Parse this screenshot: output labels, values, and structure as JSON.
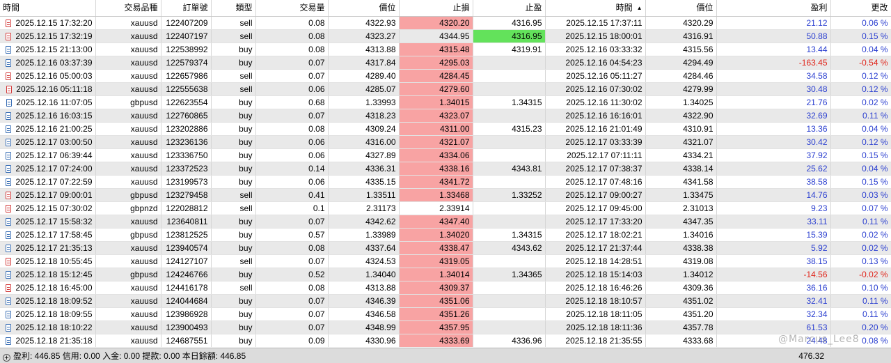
{
  "columns": {
    "open_time": "時間",
    "symbol": "交易品種",
    "order": "訂單號",
    "type": "類型",
    "volume": "交易量",
    "open_price": "價位",
    "sl": "止損",
    "tp": "止盈",
    "close_time": "時間",
    "close_price": "價位",
    "profit": "盈利",
    "change": "更改"
  },
  "rows": [
    {
      "open_time": "2025.12.15 17:32:20",
      "symbol": "xauusd",
      "order": "122407209",
      "type": "sell",
      "volume": "0.08",
      "open_price": "4322.93",
      "sl": "4320.20",
      "tp": "4316.95",
      "close_time": "2025.12.15 17:37:11",
      "close_price": "4320.29",
      "profit": "21.12",
      "change": "0.06 %"
    },
    {
      "open_time": "2025.12.15 17:32:19",
      "symbol": "xauusd",
      "order": "122407197",
      "type": "sell",
      "volume": "0.08",
      "open_price": "4323.27",
      "sl": "4344.95",
      "tp": "4316.95",
      "close_time": "2025.12.15 18:00:01",
      "close_price": "4316.91",
      "profit": "50.88",
      "change": "0.15 %"
    },
    {
      "open_time": "2025.12.15 21:13:00",
      "symbol": "xauusd",
      "order": "122538992",
      "type": "buy",
      "volume": "0.08",
      "open_price": "4313.88",
      "sl": "4315.48",
      "tp": "4319.91",
      "close_time": "2025.12.16 03:33:32",
      "close_price": "4315.56",
      "profit": "13.44",
      "change": "0.04 %"
    },
    {
      "open_time": "2025.12.16 03:37:39",
      "symbol": "xauusd",
      "order": "122579374",
      "type": "buy",
      "volume": "0.07",
      "open_price": "4317.84",
      "sl": "4295.03",
      "tp": "",
      "close_time": "2025.12.16 04:54:23",
      "close_price": "4294.49",
      "profit": "-163.45",
      "change": "-0.54 %"
    },
    {
      "open_time": "2025.12.16 05:00:03",
      "symbol": "xauusd",
      "order": "122657986",
      "type": "sell",
      "volume": "0.07",
      "open_price": "4289.40",
      "sl": "4284.45",
      "tp": "",
      "close_time": "2025.12.16 05:11:27",
      "close_price": "4284.46",
      "profit": "34.58",
      "change": "0.12 %"
    },
    {
      "open_time": "2025.12.16 05:11:18",
      "symbol": "xauusd",
      "order": "122555638",
      "type": "sell",
      "volume": "0.06",
      "open_price": "4285.07",
      "sl": "4279.60",
      "tp": "",
      "close_time": "2025.12.16 07:30:02",
      "close_price": "4279.99",
      "profit": "30.48",
      "change": "0.12 %"
    },
    {
      "open_time": "2025.12.16 11:07:05",
      "symbol": "gbpusd",
      "order": "122623554",
      "type": "buy",
      "volume": "0.68",
      "open_price": "1.33993",
      "sl": "1.34015",
      "tp": "1.34315",
      "close_time": "2025.12.16 11:30:02",
      "close_price": "1.34025",
      "profit": "21.76",
      "change": "0.02 %"
    },
    {
      "open_time": "2025.12.16 16:03:15",
      "symbol": "xauusd",
      "order": "122760865",
      "type": "buy",
      "volume": "0.07",
      "open_price": "4318.23",
      "sl": "4323.07",
      "tp": "",
      "close_time": "2025.12.16 16:16:01",
      "close_price": "4322.90",
      "profit": "32.69",
      "change": "0.11 %"
    },
    {
      "open_time": "2025.12.16 21:00:25",
      "symbol": "xauusd",
      "order": "123202886",
      "type": "buy",
      "volume": "0.08",
      "open_price": "4309.24",
      "sl": "4311.00",
      "tp": "4315.23",
      "close_time": "2025.12.16 21:01:49",
      "close_price": "4310.91",
      "profit": "13.36",
      "change": "0.04 %"
    },
    {
      "open_time": "2025.12.17 03:00:50",
      "symbol": "xauusd",
      "order": "123236136",
      "type": "buy",
      "volume": "0.06",
      "open_price": "4316.00",
      "sl": "4321.07",
      "tp": "",
      "close_time": "2025.12.17 03:33:39",
      "close_price": "4321.07",
      "profit": "30.42",
      "change": "0.12 %"
    },
    {
      "open_time": "2025.12.17 06:39:44",
      "symbol": "xauusd",
      "order": "123336750",
      "type": "buy",
      "volume": "0.06",
      "open_price": "4327.89",
      "sl": "4334.06",
      "tp": "",
      "close_time": "2025.12.17 07:11:11",
      "close_price": "4334.21",
      "profit": "37.92",
      "change": "0.15 %"
    },
    {
      "open_time": "2025.12.17 07:24:00",
      "symbol": "xauusd",
      "order": "123372523",
      "type": "buy",
      "volume": "0.14",
      "open_price": "4336.31",
      "sl": "4338.16",
      "tp": "4343.81",
      "close_time": "2025.12.17 07:38:37",
      "close_price": "4338.14",
      "profit": "25.62",
      "change": "0.04 %"
    },
    {
      "open_time": "2025.12.17 07:22:59",
      "symbol": "xauusd",
      "order": "123199573",
      "type": "buy",
      "volume": "0.06",
      "open_price": "4335.15",
      "sl": "4341.72",
      "tp": "",
      "close_time": "2025.12.17 07:48:16",
      "close_price": "4341.58",
      "profit": "38.58",
      "change": "0.15 %"
    },
    {
      "open_time": "2025.12.17 09:00:01",
      "symbol": "gbpusd",
      "order": "123279458",
      "type": "sell",
      "volume": "0.41",
      "open_price": "1.33511",
      "sl": "1.33468",
      "tp": "1.33252",
      "close_time": "2025.12.17 09:00:27",
      "close_price": "1.33475",
      "profit": "14.76",
      "change": "0.03 %"
    },
    {
      "open_time": "2025.12.15 07:30:02",
      "symbol": "gbpnzd",
      "order": "122028812",
      "type": "sell",
      "volume": "0.1",
      "open_price": "2.31173",
      "sl": "2.33914",
      "tp": "",
      "close_time": "2025.12.17 09:45:00",
      "close_price": "2.31013",
      "profit": "9.23",
      "change": "0.07 %"
    },
    {
      "open_time": "2025.12.17 15:58:32",
      "symbol": "xauusd",
      "order": "123640811",
      "type": "buy",
      "volume": "0.07",
      "open_price": "4342.62",
      "sl": "4347.40",
      "tp": "",
      "close_time": "2025.12.17 17:33:20",
      "close_price": "4347.35",
      "profit": "33.11",
      "change": "0.11 %"
    },
    {
      "open_time": "2025.12.17 17:58:45",
      "symbol": "gbpusd",
      "order": "123812525",
      "type": "buy",
      "volume": "0.57",
      "open_price": "1.33989",
      "sl": "1.34020",
      "tp": "1.34315",
      "close_time": "2025.12.17 18:02:21",
      "close_price": "1.34016",
      "profit": "15.39",
      "change": "0.02 %"
    },
    {
      "open_time": "2025.12.17 21:35:13",
      "symbol": "xauusd",
      "order": "123940574",
      "type": "buy",
      "volume": "0.08",
      "open_price": "4337.64",
      "sl": "4338.47",
      "tp": "4343.62",
      "close_time": "2025.12.17 21:37:44",
      "close_price": "4338.38",
      "profit": "5.92",
      "change": "0.02 %"
    },
    {
      "open_time": "2025.12.18 10:55:45",
      "symbol": "xauusd",
      "order": "124127107",
      "type": "sell",
      "volume": "0.07",
      "open_price": "4324.53",
      "sl": "4319.05",
      "tp": "",
      "close_time": "2025.12.18 14:28:51",
      "close_price": "4319.08",
      "profit": "38.15",
      "change": "0.13 %"
    },
    {
      "open_time": "2025.12.18 15:12:45",
      "symbol": "gbpusd",
      "order": "124246766",
      "type": "buy",
      "volume": "0.52",
      "open_price": "1.34040",
      "sl": "1.34014",
      "tp": "1.34365",
      "close_time": "2025.12.18 15:14:03",
      "close_price": "1.34012",
      "profit": "-14.56",
      "change": "-0.02 %"
    },
    {
      "open_time": "2025.12.18 16:45:00",
      "symbol": "xauusd",
      "order": "124416178",
      "type": "sell",
      "volume": "0.08",
      "open_price": "4313.88",
      "sl": "4309.37",
      "tp": "",
      "close_time": "2025.12.18 16:46:26",
      "close_price": "4309.36",
      "profit": "36.16",
      "change": "0.10 %"
    },
    {
      "open_time": "2025.12.18 18:09:52",
      "symbol": "xauusd",
      "order": "124044684",
      "type": "buy",
      "volume": "0.07",
      "open_price": "4346.39",
      "sl": "4351.06",
      "tp": "",
      "close_time": "2025.12.18 18:10:57",
      "close_price": "4351.02",
      "profit": "32.41",
      "change": "0.11 %"
    },
    {
      "open_time": "2025.12.18 18:09:55",
      "symbol": "xauusd",
      "order": "123986928",
      "type": "buy",
      "volume": "0.07",
      "open_price": "4346.58",
      "sl": "4351.26",
      "tp": "",
      "close_time": "2025.12.18 18:11:05",
      "close_price": "4351.20",
      "profit": "32.34",
      "change": "0.11 %"
    },
    {
      "open_time": "2025.12.18 18:10:22",
      "symbol": "xauusd",
      "order": "123900493",
      "type": "buy",
      "volume": "0.07",
      "open_price": "4348.99",
      "sl": "4357.95",
      "tp": "",
      "close_time": "2025.12.18 18:11:36",
      "close_price": "4357.78",
      "profit": "61.53",
      "change": "0.20 %"
    },
    {
      "open_time": "2025.12.18 21:35:18",
      "symbol": "xauusd",
      "order": "124687551",
      "type": "buy",
      "volume": "0.09",
      "open_price": "4330.96",
      "sl": "4333.69",
      "tp": "4336.96",
      "close_time": "2025.12.18 21:35:55",
      "close_price": "4333.68",
      "profit": "24.48",
      "change": "0.08 %"
    }
  ],
  "footer": {
    "summary": "盈利: 446.85  信用: 0.00  入金: 0.00  提款: 0.00  本日餘額: 446.85",
    "total_profit": "476.32"
  },
  "watermark": "@Marcus_Lee8",
  "colors": {
    "sl_hit": "#f8a3a3",
    "tp_hit": "#63e25b",
    "positive": "#2b3fd0",
    "negative": "#e0241a",
    "alt_row": "#e9e9e9"
  }
}
